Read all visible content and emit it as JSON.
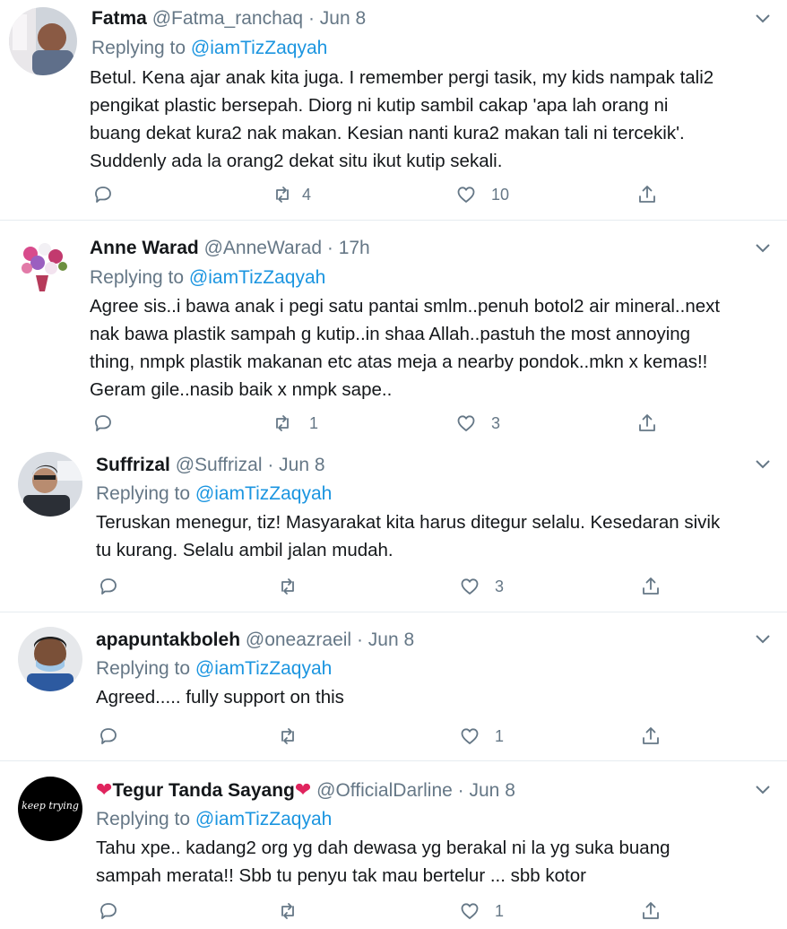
{
  "replying_to_prefix": "Replying to",
  "tweets": [
    {
      "name": "Fatma",
      "handle": "@Fatma_ranchaq",
      "time": "Jun 8",
      "mention": "@iamTizZaqyah",
      "text": "Betul. Kena ajar anak kita juga. I remember pergi tasik, my kids nampak tali2\npengikat plastic bersepah. Diorg ni kutip sambil cakap 'apa lah orang ni\nbuang dekat kura2 nak makan. Kesian nanti kura2 makan tali ni tercekik'.\nSuddenly ada la orang2 dekat situ ikut kutip sekali.",
      "retweets": "4",
      "likes": "10"
    },
    {
      "name": "Anne Warad",
      "handle": "@AnneWarad",
      "time": "17h",
      "mention": "@iamTizZaqyah",
      "text": "Agree sis..i bawa anak i pegi satu pantai smlm..penuh botol2 air mineral..next\nnak bawa plastik sampah g kutip..in shaa Allah..pastuh the most annoying\nthing, nmpk plastik makanan etc atas meja a nearby pondok..mkn x kemas!!\nGeram gile..nasib baik x nmpk sape..",
      "retweets": "1",
      "likes": "3"
    },
    {
      "name": "Suffrizal",
      "handle": "@Suffrizal",
      "time": "Jun 8",
      "mention": "@iamTizZaqyah",
      "text": "Teruskan menegur, tiz! Masyarakat kita harus ditegur selalu. Kesedaran sivik\ntu kurang. Selalu ambil jalan mudah.",
      "retweets": "",
      "likes": "3"
    },
    {
      "name": "apapuntakboleh",
      "handle": "@oneazraeil",
      "time": "Jun 8",
      "mention": "@iamTizZaqyah",
      "text": "Agreed..... fully support on this",
      "retweets": "",
      "likes": "1"
    },
    {
      "name": "Tegur Tanda Sayang",
      "handle": "@OfficialDarline",
      "time": "Jun 8",
      "mention": "@iamTizZaqyah",
      "text": "Tahu xpe.. kadang2 org yg dah dewasa yg berakal ni la yg suka buang\nsampah merata!!  Sbb tu penyu tak mau bertelur ... sbb kotor",
      "retweets": "",
      "likes": "1",
      "avatar_text": "keep trying",
      "name_emoji": "❤"
    }
  ],
  "colors": {
    "link": "#1b95e0",
    "secondary": "#657786",
    "text": "#14171a",
    "divider": "#e6ecf0"
  }
}
